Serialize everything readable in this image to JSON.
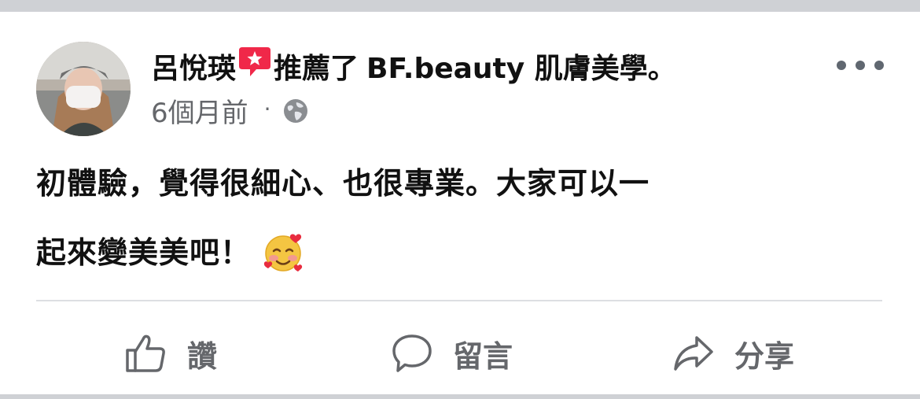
{
  "post": {
    "author": "呂悅瑛",
    "recommend_icon": "recommendation-star-bubble-icon",
    "action_text": "推薦了",
    "page_name": "BF.beauty 肌膚美學",
    "period": "。",
    "timestamp": "6個月前",
    "separator": "·",
    "privacy_icon": "globe-icon",
    "more_icon": "more-horizontal-icon",
    "text_line1": "初體驗，覺得很細心、也很專業。大家可以一",
    "text_line2": "起來變美美吧！",
    "emoji": "smiling-face-with-hearts"
  },
  "actions": {
    "like_label": "讚",
    "comment_label": "留言",
    "share_label": "分享"
  },
  "colors": {
    "background": "#cfd1d5",
    "card": "#ffffff",
    "text_primary": "#111111",
    "text_secondary": "#65676b",
    "recommend_red": "#f02849",
    "divider": "#dddfe2"
  }
}
